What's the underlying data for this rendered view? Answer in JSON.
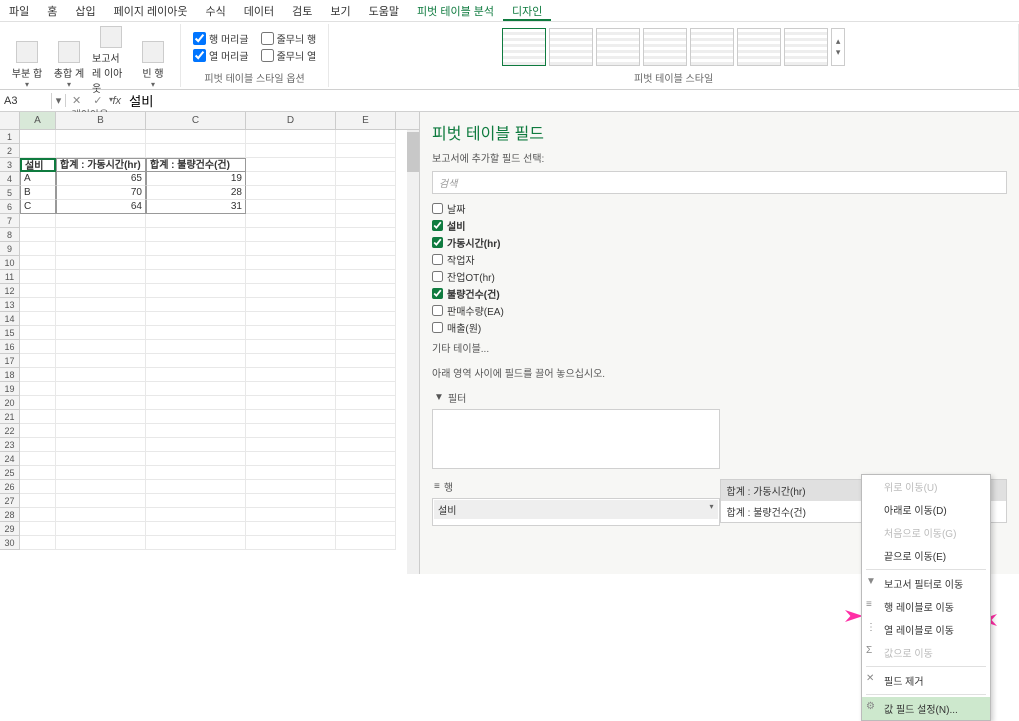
{
  "ribbon": {
    "tabs": [
      "파일",
      "홈",
      "삽입",
      "페이지 레이아웃",
      "수식",
      "데이터",
      "검토",
      "보기",
      "도움말",
      "피벗 테이블 분석",
      "디자인"
    ],
    "active_tab_index": 10,
    "group_layout": {
      "label": "레이아웃",
      "buttons": [
        "부분\n합",
        "총합\n계",
        "보고서 레\n이아웃",
        "빈 행"
      ]
    },
    "group_style_options": {
      "label": "피벗 테이블 스타일 옵션",
      "checks": [
        {
          "label": "행 머리글",
          "checked": true
        },
        {
          "label": "줄무늬 행",
          "checked": false
        },
        {
          "label": "열 머리글",
          "checked": true
        },
        {
          "label": "줄무늬 열",
          "checked": false
        }
      ]
    },
    "group_styles": {
      "label": "피벗 테이블 스타일"
    }
  },
  "namebox": {
    "ref": "A3",
    "formula": "설비"
  },
  "grid": {
    "columns": [
      "A",
      "B",
      "C",
      "D",
      "E"
    ],
    "pivot_headers": [
      "설비",
      "합계 : 가동시간(hr)",
      "합계 : 불량건수(건)"
    ],
    "rows": [
      {
        "a": "A",
        "b": "65",
        "c": "19"
      },
      {
        "a": "B",
        "b": "70",
        "c": "28"
      },
      {
        "a": "C",
        "b": "64",
        "c": "31"
      }
    ]
  },
  "pane": {
    "title": "피벗 테이블 필드",
    "subtitle": "보고서에 추가할 필드 선택:",
    "search_placeholder": "검색",
    "fields": [
      {
        "name": "날짜",
        "checked": false
      },
      {
        "name": "설비",
        "checked": true
      },
      {
        "name": "가동시간(hr)",
        "checked": true
      },
      {
        "name": "작업자",
        "checked": false
      },
      {
        "name": "잔업OT(hr)",
        "checked": false
      },
      {
        "name": "불량건수(건)",
        "checked": true
      },
      {
        "name": "판매수량(EA)",
        "checked": false
      },
      {
        "name": "매출(원)",
        "checked": false
      }
    ],
    "other_tables": "기타 테이블...",
    "drag_hint": "아래 영역 사이에 필드를 끌어 놓으십시오.",
    "area_filters": "필터",
    "area_rows": "행",
    "row_chip": "설비",
    "values_label_1": "합계 : 가동시간(hr)",
    "values_label_2": "합계 : 불량건수(건)"
  },
  "menu": {
    "items": [
      {
        "label": "위로 이동(U)",
        "disabled": true
      },
      {
        "label": "아래로 이동(D)",
        "disabled": false
      },
      {
        "label": "처음으로 이동(G)",
        "disabled": true
      },
      {
        "label": "끝으로 이동(E)",
        "disabled": false
      },
      {
        "sep": true
      },
      {
        "label": "보고서 필터로 이동",
        "icon": "▼"
      },
      {
        "label": "행 레이블로 이동",
        "icon": "≡"
      },
      {
        "label": "열 레이블로 이동",
        "icon": "⋮"
      },
      {
        "label": "값으로 이동",
        "disabled": true,
        "icon": "Σ"
      },
      {
        "sep": true
      },
      {
        "label": "필드 제거",
        "icon": "✕"
      },
      {
        "sep": true
      },
      {
        "label": "값 필드 설정(N)...",
        "icon": "⚙",
        "selected": true
      }
    ]
  }
}
